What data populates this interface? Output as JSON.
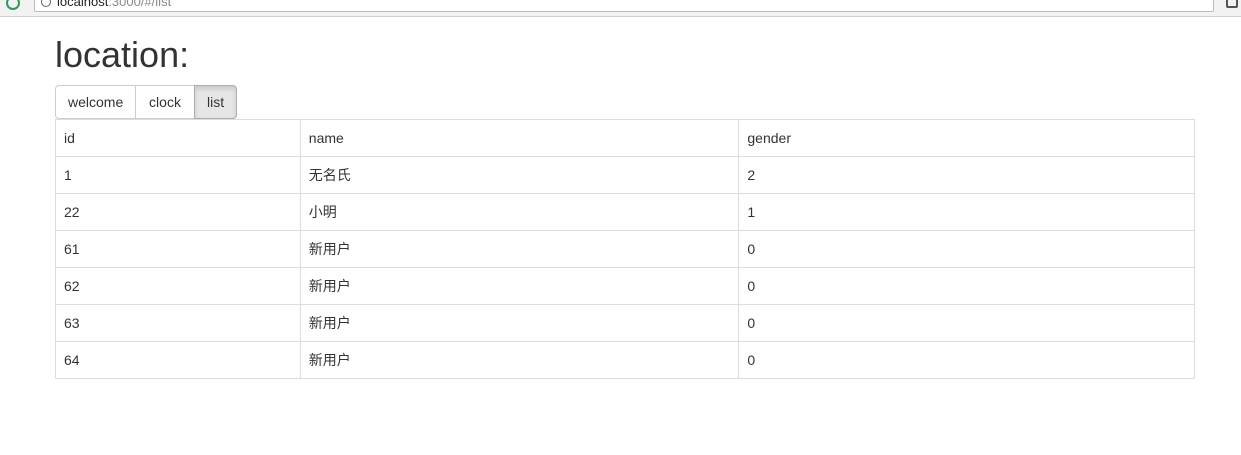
{
  "browser": {
    "url_host": "localhost",
    "url_path": ":3000/#/list"
  },
  "page": {
    "title": "location:"
  },
  "nav": {
    "buttons": [
      {
        "label": "welcome",
        "active": false
      },
      {
        "label": "clock",
        "active": false
      },
      {
        "label": "list",
        "active": true
      }
    ]
  },
  "table": {
    "headers": [
      "id",
      "name",
      "gender"
    ],
    "rows": [
      [
        "1",
        "无名氏",
        "2"
      ],
      [
        "22",
        "小明",
        "1"
      ],
      [
        "61",
        "新用户",
        "0"
      ],
      [
        "62",
        "新用户",
        "0"
      ],
      [
        "63",
        "新用户",
        "0"
      ],
      [
        "64",
        "新用户",
        "0"
      ]
    ]
  },
  "icons": {
    "reload": "reload-icon",
    "info": "info-icon",
    "extension": "extension-icon"
  },
  "colors": {
    "active_button_bg": "#e6e6e6",
    "table_border": "#dddddd",
    "text": "#333333"
  }
}
